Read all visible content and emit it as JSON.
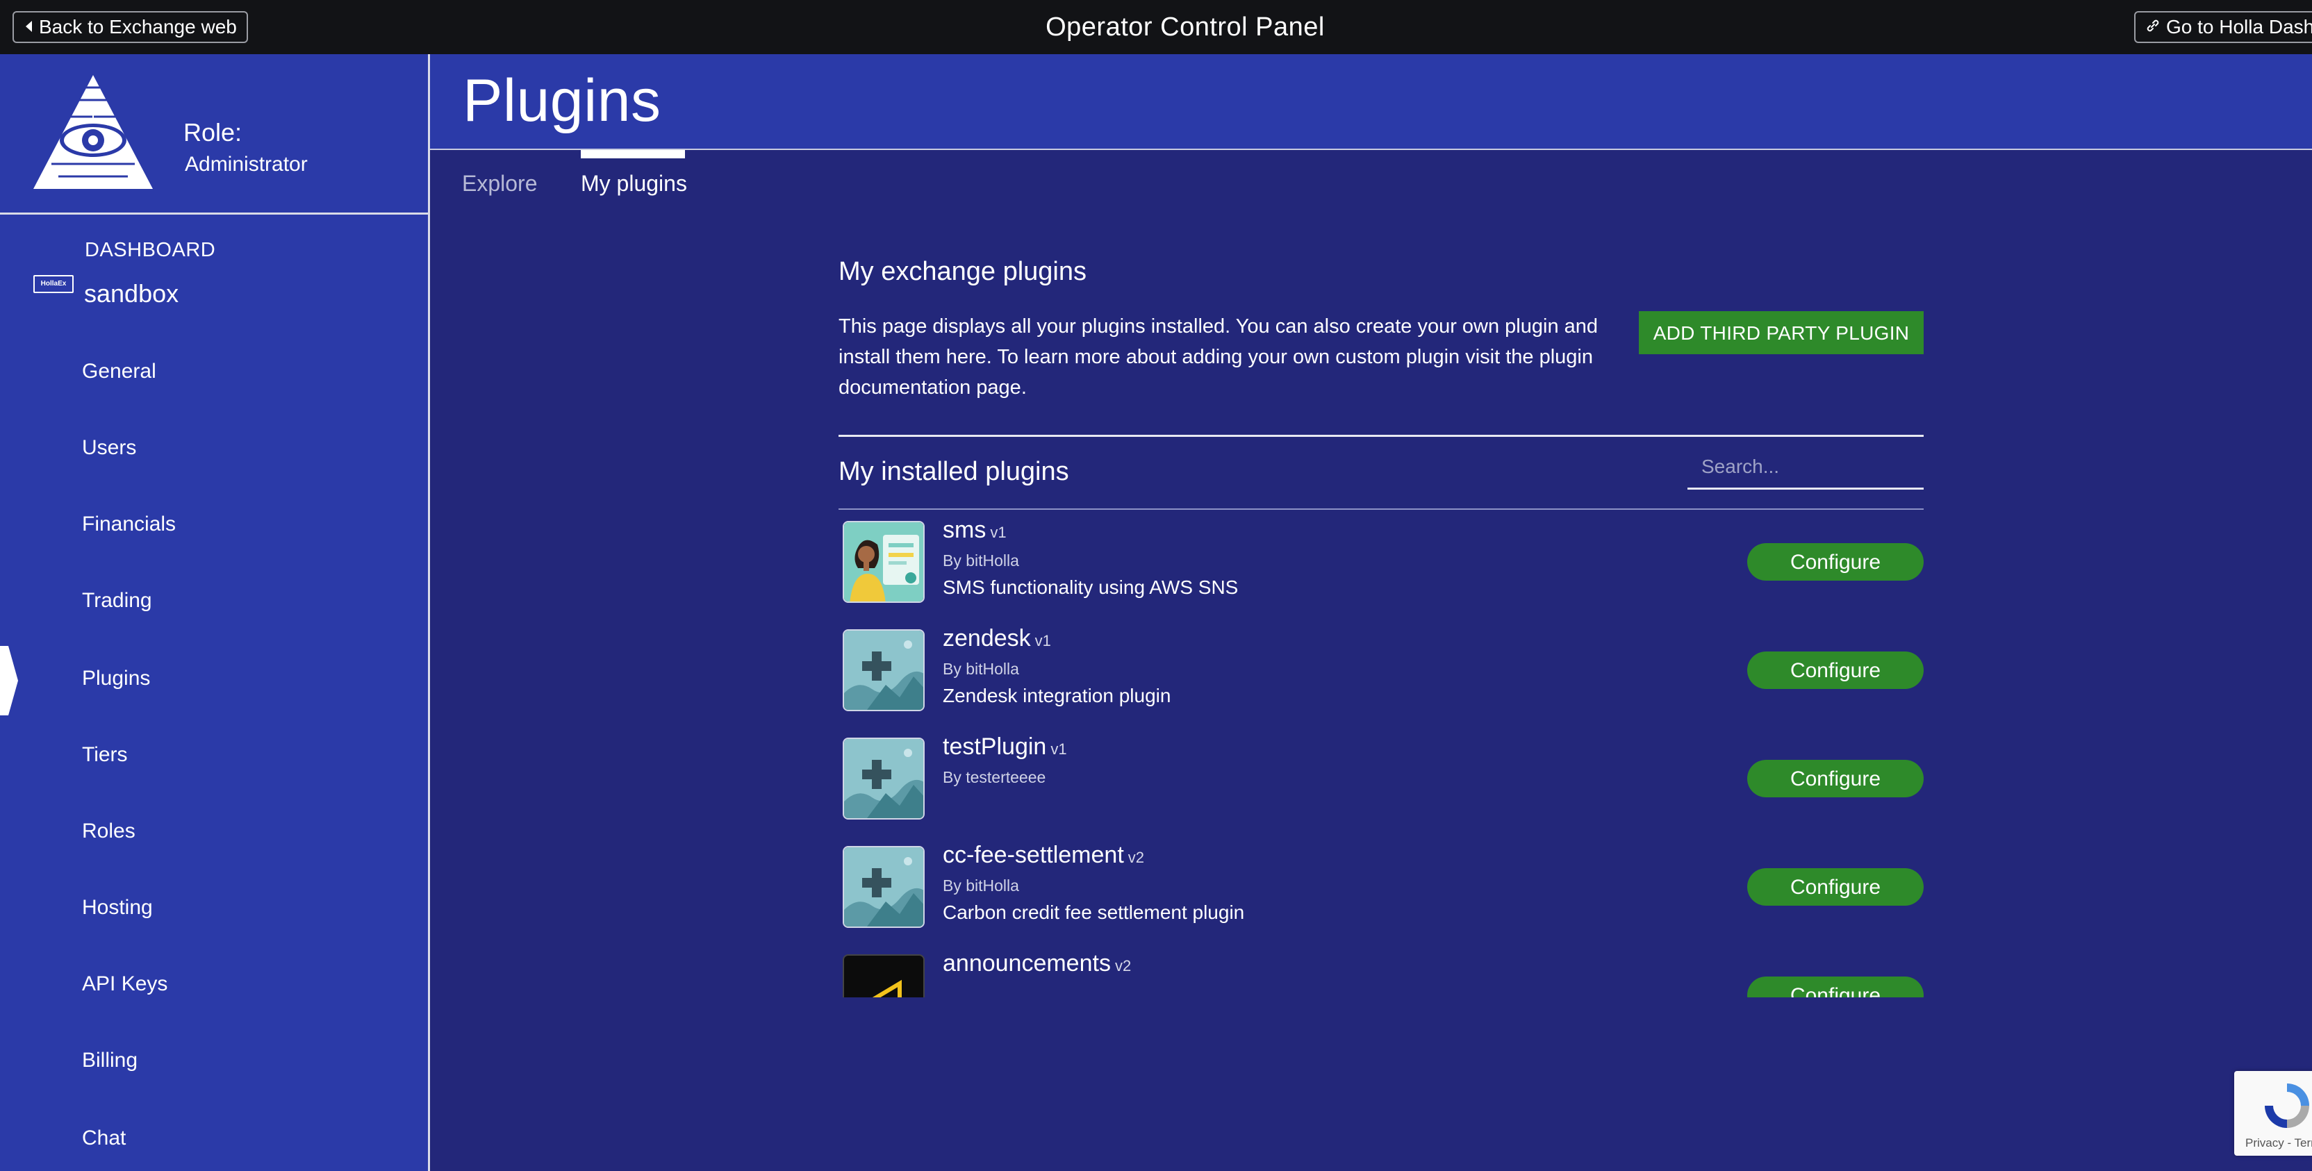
{
  "topbar": {
    "back_label": "Back to Exchange web",
    "title": "Operator Control Panel",
    "dash_label": "Go to Holla Dash"
  },
  "sidebar": {
    "role_title": "Role:",
    "role_value": "Administrator",
    "dashboard_label": "DASHBOARD",
    "exchange_badge": "HollaEx",
    "exchange_name": "sandbox",
    "items": [
      {
        "label": "General"
      },
      {
        "label": "Users"
      },
      {
        "label": "Financials"
      },
      {
        "label": "Trading"
      },
      {
        "label": "Plugins",
        "active": true
      },
      {
        "label": "Tiers"
      },
      {
        "label": "Roles"
      },
      {
        "label": "Hosting"
      },
      {
        "label": "API Keys"
      },
      {
        "label": "Billing"
      },
      {
        "label": "Chat"
      }
    ]
  },
  "main": {
    "page_title": "Plugins",
    "tabs": [
      {
        "label": "Explore",
        "active": false
      },
      {
        "label": "My plugins",
        "active": true
      }
    ],
    "section_title": "My exchange plugins",
    "description": "This page displays all your plugins installed. You can also create your own plugin and install them here. To learn more about adding your own custom plugin visit the plugin documentation page.",
    "add_button_label": "ADD THIRD PARTY PLUGIN",
    "installed_title": "My installed plugins",
    "search_placeholder": "Search...",
    "configure_label": "Configure",
    "plugins": [
      {
        "name": "sms",
        "version": "v1",
        "author": "By bitHolla",
        "description": "SMS functionality using AWS SNS",
        "icon": "sms-person-icon"
      },
      {
        "name": "zendesk",
        "version": "v1",
        "author": "By bitHolla",
        "description": "Zendesk integration plugin",
        "icon": "plugin-default-icon"
      },
      {
        "name": "testPlugin",
        "version": "v1",
        "author": "By testerteeee",
        "description": "",
        "icon": "plugin-default-icon"
      },
      {
        "name": "cc-fee-settlement",
        "version": "v2",
        "author": "By bitHolla",
        "description": "Carbon credit fee settlement plugin",
        "icon": "plugin-default-icon"
      },
      {
        "name": "announcements",
        "version": "v2",
        "author": "",
        "description": "",
        "icon": "megaphone-icon"
      }
    ]
  },
  "recaptcha": {
    "text": "Privacy - Terms"
  },
  "colors": {
    "topbar_bg": "#121316",
    "sidebar_bg": "#2b3aa8",
    "main_bg": "#23277a",
    "accent_green": "#2e8a2a"
  }
}
